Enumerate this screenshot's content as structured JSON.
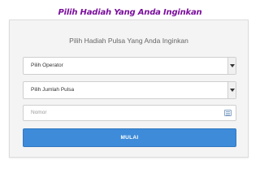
{
  "banner": {
    "text": "Pilih Hadiah Yang Anda Inginkan"
  },
  "card": {
    "title": "Pilih Hadiah Pulsa Yang Anda Inginkan",
    "operator_select": {
      "value": "Pilih Operator"
    },
    "amount_select": {
      "value": "Pilih Jumlah Pulsa"
    },
    "number_input": {
      "placeholder": "Nomor",
      "icon": "keyboard-icon"
    },
    "start_button": {
      "label": "MULAI"
    }
  },
  "colors": {
    "banner": "#7a0f9c",
    "button": "#3d8bd9",
    "card_background": "#f4f4f4"
  }
}
